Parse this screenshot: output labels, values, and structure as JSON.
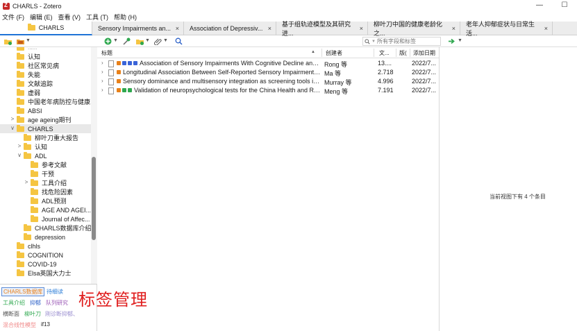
{
  "window": {
    "title": "CHARLS - Zotero",
    "minimize": "—",
    "maximize": "☐"
  },
  "menu": [
    "文件 (F)",
    "编辑 (E)",
    "查看 (V)",
    "工具 (T)",
    "帮助 (H)"
  ],
  "tabs": {
    "library": "CHARLS",
    "items": [
      "Sensory Impairments an...",
      "Association of Depressiv...",
      "基于组轨迹模型及其研究进...",
      "柳叶刀中国的健康老龄化之...",
      "老年人抑郁症状与日常生活..."
    ],
    "close": "×"
  },
  "search": {
    "placeholder": "所有字段和标签",
    "icon": "search-icon"
  },
  "collections": [
    {
      "label": "认知",
      "level": 0
    },
    {
      "label": "社区常见病",
      "level": 0
    },
    {
      "label": "失能",
      "level": 0
    },
    {
      "label": "文献追踪",
      "level": 0
    },
    {
      "label": "虚弱",
      "level": 0
    },
    {
      "label": "中国老年病防控与健康...",
      "level": 0
    },
    {
      "label": "ABSI",
      "level": 0
    },
    {
      "label": "age ageing期刊",
      "level": 0,
      "twisty": ">"
    },
    {
      "label": "CHARLS",
      "level": 0,
      "twisty": "∨",
      "selected": true
    },
    {
      "label": "柳叶刀重大报告",
      "level": 1
    },
    {
      "label": "认知",
      "level": 1,
      "twisty": ">"
    },
    {
      "label": "ADL",
      "level": 1,
      "twisty": "∨"
    },
    {
      "label": "参考文献",
      "level": 2
    },
    {
      "label": "干预",
      "level": 2
    },
    {
      "label": "工具介绍",
      "level": 2,
      "twisty": ">"
    },
    {
      "label": "找危险因素",
      "level": 2
    },
    {
      "label": "ADL预测",
      "level": 2
    },
    {
      "label": "AGE AND AGEI...",
      "level": 2
    },
    {
      "label": "Journal of Affec...",
      "level": 2
    },
    {
      "label": "CHARLS数据库介绍",
      "level": 1
    },
    {
      "label": "depression",
      "level": 1
    },
    {
      "label": "clhls",
      "level": 0
    },
    {
      "label": "COGNITION",
      "level": 0
    },
    {
      "label": "COVID-19",
      "level": 0
    },
    {
      "label": "Elsa英国大力士",
      "level": 0
    }
  ],
  "columns": {
    "title": "标题",
    "creator": "创建者",
    "extra": "文...",
    "version": "版(",
    "date_added": "添加日期"
  },
  "items": [
    {
      "title": "Association of Sensory Impairments With Cognitive Decline and D...",
      "creator": "Rong 等",
      "extra": "13....",
      "date": "2022/7...",
      "tags": [
        "#e8811a",
        "#3a64d8",
        "#3a64d8",
        "#3a64d8"
      ]
    },
    {
      "title": "Longitudinal Association Between Self-Reported Sensory Impairments a...",
      "creator": "Ma 等",
      "extra": "2.718",
      "date": "2022/7...",
      "tags": [
        "#e8811a"
      ]
    },
    {
      "title": "Sensory dominance and multisensory integration as screening tools in a...",
      "creator": "Murray 等",
      "extra": "4.996",
      "date": "2022/7...",
      "tags": [
        "#e8811a"
      ]
    },
    {
      "title": "Validation of neuropsychological tests for the China Health and Reti...",
      "creator": "Meng 等",
      "extra": "7.191",
      "date": "2022/7...",
      "tags": [
        "#e8811a",
        "#2fa84f",
        "#2fa84f"
      ]
    }
  ],
  "tags": {
    "row1": [
      {
        "label": "CHARLS数据库",
        "color": "#e8811a",
        "selected": true
      },
      {
        "label": "待细读",
        "color": "#2d7fd8"
      }
    ],
    "row2": [
      {
        "label": "工具介绍",
        "color": "#2fa84f"
      },
      {
        "label": "抑郁",
        "color": "#2d62c8"
      },
      {
        "label": "队列研究",
        "color": "#9b59b6"
      }
    ],
    "row3": [
      {
        "label": "横断面",
        "color": "#555555"
      },
      {
        "label": "柳叶刀",
        "color": "#2fa84f"
      },
      {
        "label": "刚诊断抑郁、",
        "color": "#9b8fd0"
      }
    ],
    "row4": [
      {
        "label": "混合线性模型",
        "color": "#f08a8a"
      },
      {
        "label": "if13",
        "color": "#222222"
      }
    ],
    "overlay": "标签管理"
  },
  "status": {
    "count_message": "当前视图下有 4 个条目"
  }
}
